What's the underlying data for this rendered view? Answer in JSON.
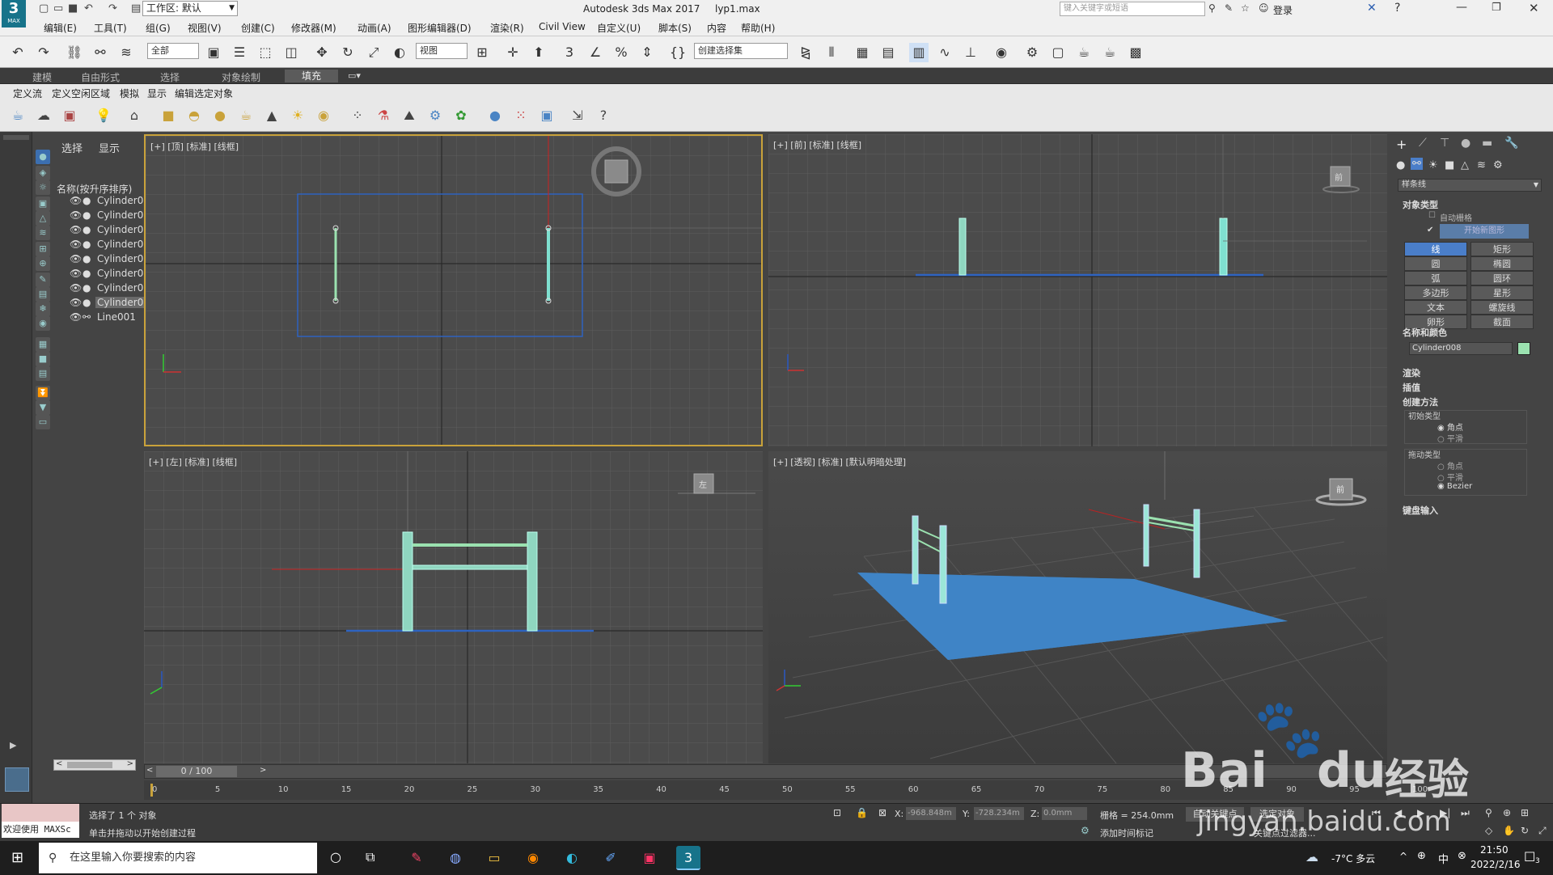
{
  "titlebar": {
    "app_icon": "3",
    "app_icon_sub": "MAX",
    "workspace": "工作区: 默认",
    "title": "Autodesk 3ds Max 2017",
    "filename": "lyp1.max",
    "search_placeholder": "键入关键字或短语",
    "login": "登录"
  },
  "menu": [
    "编辑(E)",
    "工具(T)",
    "组(G)",
    "视图(V)",
    "创建(C)",
    "修改器(M)",
    "动画(A)",
    "图形编辑器(D)",
    "渲染(R)",
    "Civil View",
    "自定义(U)",
    "脚本(S)",
    "内容",
    "帮助(H)"
  ],
  "toolbar": {
    "filter_dropdown": "全部",
    "coord_dropdown": "视图",
    "selection_set": "创建选择集"
  },
  "ribbon_tabs": [
    "建模",
    "自由形式",
    "选择",
    "对象绘制",
    "填充"
  ],
  "ribbon_sub": [
    "定义流",
    "定义空闲区域",
    "模拟",
    "显示",
    "编辑选定对象"
  ],
  "explorer": {
    "tabs": [
      "选择",
      "显示"
    ],
    "header": "名称(按升序排序)",
    "items": [
      "Cylinder0",
      "Cylinder0",
      "Cylinder0",
      "Cylinder0",
      "Cylinder0",
      "Cylinder0",
      "Cylinder0",
      "Cylinder0",
      "Line001"
    ]
  },
  "viewports": {
    "top": "[+] [顶] [标准] [线框]",
    "front": "[+] [前] [标准] [线框]",
    "left": "[+] [左] [标准] [线框]",
    "persp": "[+] [透视] [标准] [默认明暗处理]",
    "front_cube": "前",
    "left_cube": "左",
    "persp_cube": "前"
  },
  "command_panel": {
    "dropdown": "样条线",
    "object_type": "对象类型",
    "auto_grid": "自动栅格",
    "start_new_shape": "开始新图形",
    "buttons": [
      "线",
      "矩形",
      "圆",
      "椭圆",
      "弧",
      "圆环",
      "多边形",
      "星形",
      "文本",
      "螺旋线",
      "卵形",
      "截面"
    ],
    "name_color": "名称和颜色",
    "object_name": "Cylinder008",
    "object_color": "#9be2b0",
    "rollouts": [
      "渲染",
      "插值",
      "创建方法"
    ],
    "initial_type": "初始类型",
    "initial_options": [
      "角点",
      "平滑"
    ],
    "drag_type": "拖动类型",
    "drag_options": [
      "角点",
      "平滑",
      "Bezier"
    ],
    "keyboard_input": "键盘输入"
  },
  "timeline": {
    "frame_counter": "0 / 100",
    "ticks": [
      "0",
      "5",
      "10",
      "15",
      "20",
      "25",
      "30",
      "35",
      "40",
      "45",
      "50",
      "55",
      "60",
      "65",
      "70",
      "75",
      "80",
      "85",
      "90",
      "95",
      "100"
    ]
  },
  "status": {
    "maxscript": "欢迎使用 MAXSc",
    "selected": "选择了 1 个 对象",
    "hint": "单击并拖动以开始创建过程",
    "x_label": "X:",
    "x_value": "-968.848m",
    "y_label": "Y:",
    "y_value": "-728.234m",
    "z_label": "Z:",
    "z_value": "0.0mm",
    "grid": "栅格 = 254.0mm",
    "add_time_tag": "添加时间标记",
    "auto_key": "自动关键点",
    "set_key": "选定对象",
    "key_filter": "关键点过滤器..."
  },
  "taskbar": {
    "search_placeholder": "在这里输入你要搜索的内容",
    "weather": "-7°C 多云",
    "ime": "中",
    "time": "21:50",
    "date": "2022/2/16",
    "notify": "3"
  },
  "watermark": {
    "brand": "Bai",
    "brand2": "du",
    "suffix": "经验",
    "url": "jingyan.baidu.com"
  }
}
